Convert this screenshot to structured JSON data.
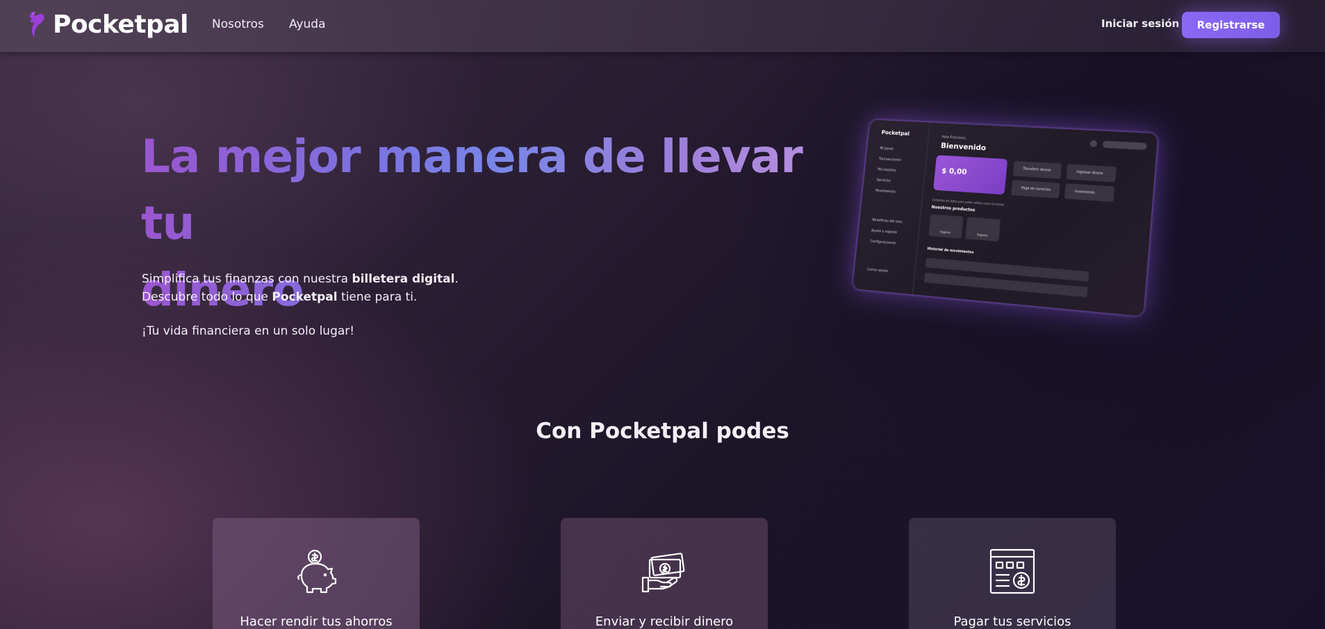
{
  "nav": {
    "brand": "Pocketpal",
    "links": [
      "Nosotros",
      "Ayuda"
    ],
    "login": "Iniciar sesión",
    "register": "Registrarse"
  },
  "hero": {
    "title_line1": "La mejor manera de llevar tu",
    "title_line2": "dinero",
    "p1_pre": "Simplifica tus finanzas con nuestra ",
    "p1_bold": "billetera digital",
    "p1_post": ".",
    "p2_pre": "Descubre todo lo que ",
    "p2_bold": "Pocketpal",
    "p2_post": " tiene para ti.",
    "p3": "¡Tu vida financiera en un solo lugar!"
  },
  "mockup": {
    "brand": "Pocketpal",
    "sidebar": [
      "Mi panel",
      "Transacciones",
      "Mis tarjetas",
      "Servicios",
      "Movimientos",
      "Beneficios del mes",
      "Ayuda y soporte",
      "Configuraciones",
      "Cerrar sesión"
    ],
    "greeting": "Hola Francisco,",
    "welcome": "Bienvenido",
    "balance": "$ 0,00",
    "actions": [
      "Transferir dinero",
      "Ingresar dinero",
      "Pago de servicios",
      "Inversiones"
    ],
    "note": "Completa los datos para poder utilizar estas funciones",
    "products_title": "Nuestros productos",
    "products": [
      "Seguros",
      "Seguros"
    ],
    "history_title": "Historial de movimientos"
  },
  "features": {
    "title": "Con Pocketpal podes",
    "cards": [
      {
        "label": "Hacer rendir tus ahorros",
        "icon": "piggy-bank-icon"
      },
      {
        "label": "Enviar y recibir dinero",
        "icon": "money-hand-icon"
      },
      {
        "label": "Pagar tus servicios",
        "icon": "bill-payment-icon"
      }
    ]
  },
  "colors": {
    "accent": "#8a68f5",
    "title_gradient_start": "#9b55cf",
    "title_gradient_end": "#b68fe0"
  }
}
